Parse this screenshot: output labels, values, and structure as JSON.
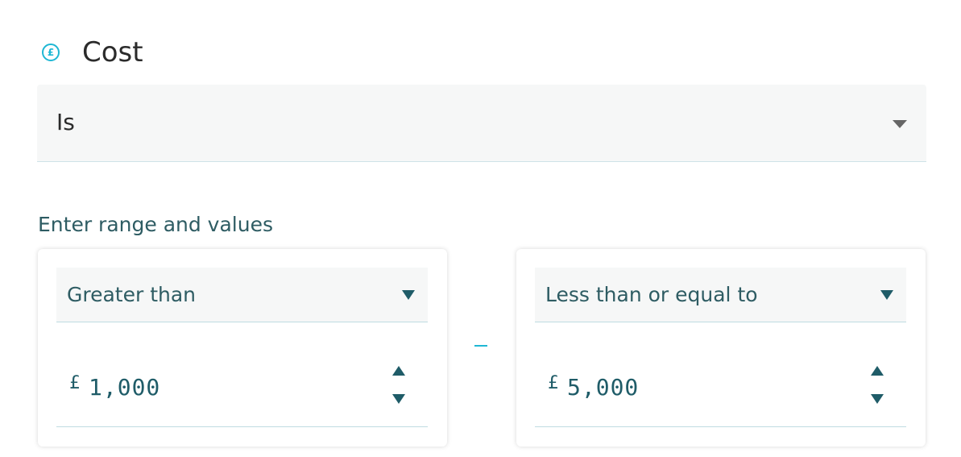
{
  "filter": {
    "icon": "pound-coin-icon",
    "icon_glyph": "£",
    "title": "Cost",
    "condition": {
      "selected": "Is",
      "icon": "caret-down-icon"
    },
    "range_label": "Enter range and values",
    "range_separator": "–",
    "lower": {
      "operator": "Greater than",
      "currency": "£",
      "value": "1,000"
    },
    "upper": {
      "operator": "Less than or equal to",
      "currency": "£",
      "value": "5,000"
    },
    "colors": {
      "accent": "#1fb7d4",
      "text_teal": "#2e5c63",
      "input_value": "#1f5c68",
      "field_background": "#f6f7f7"
    }
  }
}
